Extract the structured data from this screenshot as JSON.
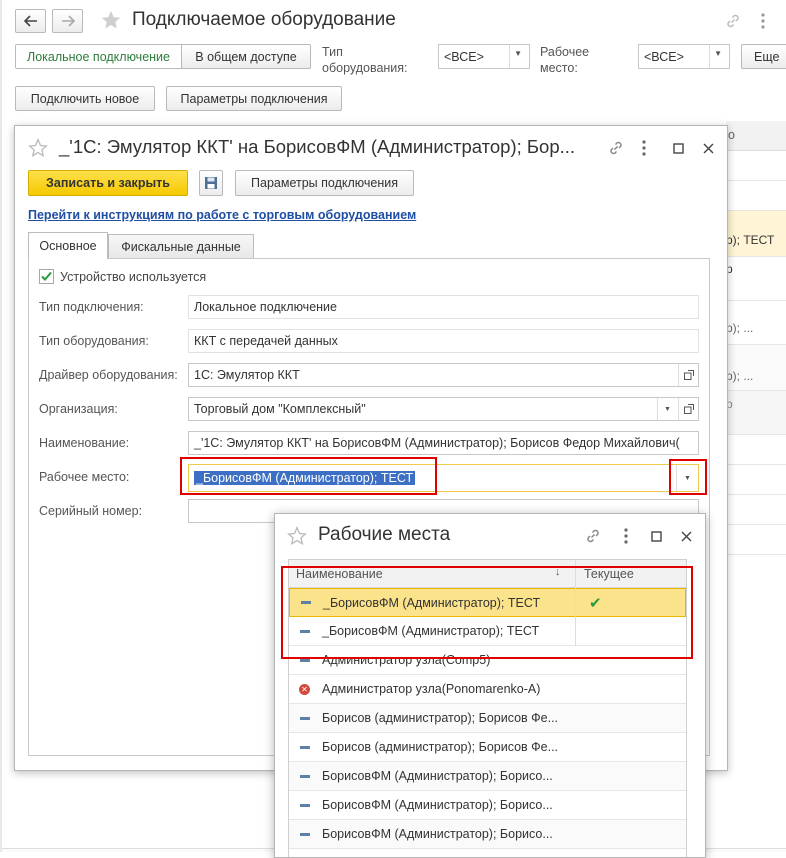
{
  "main": {
    "title": "Подключаемое оборудование",
    "seg_local": "Локальное подключение",
    "seg_shared": "В общем доступе",
    "equip_type_label_1": "Тип",
    "equip_type_label_2": "оборудования:",
    "equip_type_value": "<ВСЕ>",
    "workplace_label_1": "Рабочее",
    "workplace_label_2": "место:",
    "workplace_value": "<ВСЕ>",
    "more_label": "Еще",
    "connect_new": "Подключить новое",
    "conn_params": "Параметры подключения",
    "bg_col_header": "о",
    "bg_rows": [
      "р); ТЕСТ",
      "р",
      "р); ...",
      "р); ...",
      "р"
    ]
  },
  "device": {
    "title": "_'1С: Эмулятор ККТ' на БорисовФМ (Администратор); Бор...",
    "save_close": "Записать и закрыть",
    "conn_params": "Параметры подключения",
    "instructions_link": "Перейти к инструкциям по работе с торговым оборудованием",
    "tabs": [
      "Основное",
      "Фискальные данные"
    ],
    "in_use_label": "Устройство используется",
    "fields": {
      "conn_type_label": "Тип подключения:",
      "conn_type_value": "Локальное подключение",
      "equip_type_label": "Тип оборудования:",
      "equip_type_value": "ККТ с передачей данных",
      "driver_label": "Драйвер оборудования:",
      "driver_value": "1С: Эмулятор ККТ",
      "org_label": "Организация:",
      "org_value": "Торговый дом \"Комплексный\"",
      "name_label": "Наименование:",
      "name_value": "_'1С: Эмулятор ККТ' на БорисовФМ (Администратор); Борисов Федор Михайлович(",
      "workplace_label": "Рабочее место:",
      "workplace_value": "_БорисовФМ (Администратор); ТЕСТ",
      "serial_label": "Серийный номер:",
      "serial_value": ""
    }
  },
  "workplaces": {
    "title": "Рабочие места",
    "col_name": "Наименование",
    "col_current": "Текущее",
    "rows": [
      {
        "name": "_БорисовФМ (Администратор); ТЕСТ",
        "current": "✔"
      },
      {
        "name": "_БорисовФМ (Администратор); ТЕСТ",
        "current": ""
      },
      {
        "name": "Администратор узла(Comp5)",
        "current": ""
      },
      {
        "name": "Администратор узла(Ponomarenko-A)",
        "current": ""
      },
      {
        "name": "Борисов (администратор); Борисов Фе...",
        "current": ""
      },
      {
        "name": "Борисов (администратор); Борисов Фе...",
        "current": ""
      },
      {
        "name": "БорисовФМ (Администратор); Борисо...",
        "current": ""
      },
      {
        "name": "БорисовФМ (Администратор); Борисо...",
        "current": ""
      },
      {
        "name": "БорисовФМ (Администратор); Борисо...",
        "current": ""
      }
    ]
  }
}
